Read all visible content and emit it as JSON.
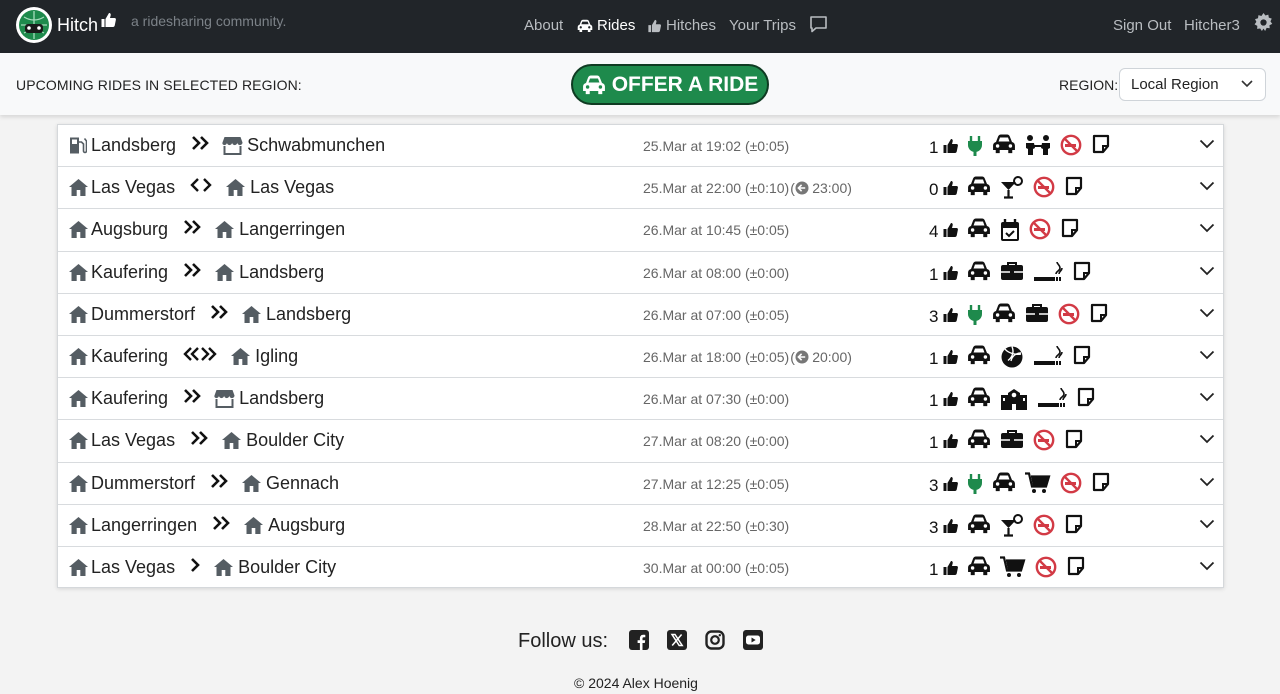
{
  "nav": {
    "brand": "Hitch",
    "tagline": "a ridesharing community.",
    "links": [
      {
        "label": "About"
      },
      {
        "label": "Rides",
        "icon": "car-icon"
      },
      {
        "label": "Hitches",
        "icon": "thumbs-up-icon"
      },
      {
        "label": "Your Trips"
      }
    ],
    "sign_out": "Sign Out",
    "username": "Hitcher3"
  },
  "subbar": {
    "heading": "UPCOMING RIDES IN SELECTED REGION:",
    "offer_label": "OFFER A RIDE",
    "region_label": "REGION:",
    "region_value": "Local Region"
  },
  "colors": {
    "navbar": "#212529",
    "offer_button": "#1e8a4c",
    "accent_green": "#1e8a4c",
    "no_smoking_red": "#d23a45"
  },
  "rides": [
    {
      "from_icon": "gas-pump-icon",
      "from": "Landsberg",
      "direction": "chevrons-right",
      "to_icon": "store-icon",
      "to": "Schwabmunchen",
      "time": "25.Mar at 19:02 (±0:05)",
      "return": "",
      "seats": "1",
      "amenities": [
        "ev-plug-icon",
        "car-icon",
        "people-icon",
        "no-smoking-icon",
        "note-icon"
      ]
    },
    {
      "from_icon": "home-icon",
      "from": "Las Vegas",
      "direction": "angle-both",
      "to_icon": "home-icon",
      "to": "Las Vegas",
      "time": "25.Mar at 22:00 (±0:10)",
      "return": "23:00",
      "seats": "0",
      "amenities": [
        "car-icon",
        "cocktail-icon",
        "no-smoking-icon",
        "note-icon"
      ]
    },
    {
      "from_icon": "home-icon",
      "from": "Augsburg",
      "direction": "chevrons-right",
      "to_icon": "home-icon",
      "to": "Langerringen",
      "time": "26.Mar at 10:45 (±0:05)",
      "return": "",
      "seats": "4",
      "amenities": [
        "car-icon",
        "calendar-check-icon",
        "no-smoking-icon",
        "note-icon"
      ]
    },
    {
      "from_icon": "home-icon",
      "from": "Kaufering",
      "direction": "chevrons-right",
      "to_icon": "home-icon",
      "to": "Landsberg",
      "time": "26.Mar at 08:00 (±0:00)",
      "return": "",
      "seats": "1",
      "amenities": [
        "car-icon",
        "briefcase-icon",
        "smoking-icon",
        "note-icon"
      ]
    },
    {
      "from_icon": "home-icon",
      "from": "Dummerstorf",
      "direction": "chevrons-right",
      "to_icon": "home-icon",
      "to": "Landsberg",
      "time": "26.Mar at 07:00 (±0:05)",
      "return": "",
      "seats": "3",
      "amenities": [
        "ev-plug-icon",
        "car-icon",
        "briefcase-icon",
        "no-smoking-icon",
        "note-icon"
      ]
    },
    {
      "from_icon": "home-icon",
      "from": "Kaufering",
      "direction": "chevrons-both",
      "to_icon": "home-icon",
      "to": "Igling",
      "time": "26.Mar at 18:00 (±0:05)",
      "return": "20:00",
      "seats": "1",
      "amenities": [
        "car-icon",
        "volleyball-icon",
        "smoking-icon",
        "note-icon"
      ]
    },
    {
      "from_icon": "home-icon",
      "from": "Kaufering",
      "direction": "chevrons-right",
      "to_icon": "store-icon",
      "to": "Landsberg",
      "time": "26.Mar at 07:30 (±0:00)",
      "return": "",
      "seats": "1",
      "amenities": [
        "car-icon",
        "school-icon",
        "smoking-icon",
        "note-icon"
      ]
    },
    {
      "from_icon": "home-icon",
      "from": "Las Vegas",
      "direction": "chevrons-right",
      "to_icon": "home-icon",
      "to": "Boulder City",
      "time": "27.Mar at 08:20 (±0:00)",
      "return": "",
      "seats": "1",
      "amenities": [
        "car-icon",
        "briefcase-icon",
        "no-smoking-icon",
        "note-icon"
      ]
    },
    {
      "from_icon": "home-icon",
      "from": "Dummerstorf",
      "direction": "chevrons-right",
      "to_icon": "home-icon",
      "to": "Gennach",
      "time": "27.Mar at 12:25 (±0:05)",
      "return": "",
      "seats": "3",
      "amenities": [
        "ev-plug-icon",
        "car-icon",
        "cart-icon",
        "no-smoking-icon",
        "note-icon"
      ]
    },
    {
      "from_icon": "home-icon",
      "from": "Langerringen",
      "direction": "chevrons-right",
      "to_icon": "home-icon",
      "to": "Augsburg",
      "time": "28.Mar at 22:50 (±0:30)",
      "return": "",
      "seats": "3",
      "amenities": [
        "car-icon",
        "cocktail-icon",
        "no-smoking-icon",
        "note-icon"
      ]
    },
    {
      "from_icon": "home-icon",
      "from": "Las Vegas",
      "direction": "chevron-right",
      "to_icon": "home-icon",
      "to": "Boulder City",
      "time": "30.Mar at 00:00 (±0:05)",
      "return": "",
      "seats": "1",
      "amenities": [
        "car-icon",
        "cart-icon",
        "no-smoking-icon",
        "note-icon"
      ]
    }
  ],
  "footer": {
    "follow": "Follow us:",
    "social": [
      "facebook-icon",
      "x-icon",
      "instagram-icon",
      "youtube-icon"
    ],
    "copyright": "© 2024 Alex Hoenig"
  }
}
